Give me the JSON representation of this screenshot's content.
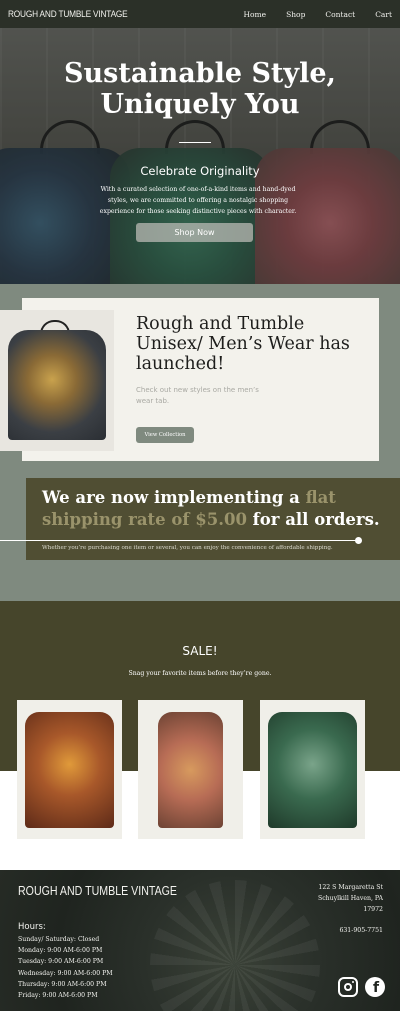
{
  "nav": {
    "brand": "ROUGH AND TUMBLE VINTAGE",
    "links": [
      "Home",
      "Shop",
      "Contact",
      "Cart"
    ]
  },
  "hero": {
    "title": "Sustainable Style, Uniquely You",
    "subtitle": "Celebrate Originality",
    "text": "With a curated selection of one-of-a-kind items and hand-dyed styles, we are committed to offering a nostalgic shopping experience for those seeking distinctive pieces with character.",
    "button": "Shop Now"
  },
  "launch": {
    "title": "Rough and Tumble Unisex/ Men’s Wear has launched!",
    "text": "Check out new styles on the men’s wear tab.",
    "button": "View Collection"
  },
  "shipping": {
    "pre": "We are now implementing a ",
    "highlight": "flat shipping rate of $5.00",
    "post": " for all orders.",
    "note": "Whether you’re purchasing one item or several, you can enjoy the convenience of affordable shipping."
  },
  "sale": {
    "title": "SALE!",
    "subtitle": "Snag your favorite items before they’re gone."
  },
  "footer": {
    "brand": "ROUGH AND TUMBLE VINTAGE",
    "address_line1": "122 S Margaretta St",
    "address_line2": "Schuylkill Haven, PA",
    "address_line3": "17972",
    "phone": "631-905-7751",
    "hours_title": "Hours:",
    "hours": [
      "Sunday/ Saturday: Closed",
      "Monday: 9:00 AM-6:00 PM",
      "Tuesday: 9:00 AM-6:00 PM",
      "Wednesday: 9:00 AM-6:00 PM",
      "Thursday: 9:00 AM-6:00 PM",
      "Friday: 9:00 AM-6:00 PM"
    ],
    "social_icons": [
      "instagram-icon",
      "facebook-icon"
    ]
  },
  "colors": {
    "nav_bg": "#2b3028",
    "sage": "#7f8a7f",
    "olive": "#504e33",
    "olive_dark": "#46452b",
    "highlight": "#9a936b"
  }
}
